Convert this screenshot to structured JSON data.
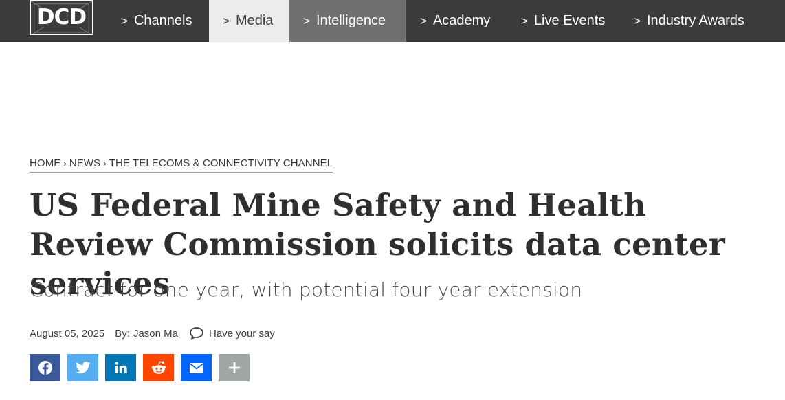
{
  "header": {
    "logo_text": "DCD",
    "nav": [
      {
        "caret": ">",
        "label": "Channels"
      },
      {
        "caret": ">",
        "label": "Media"
      },
      {
        "caret": ">",
        "label": "Intelligence"
      },
      {
        "caret": ">",
        "label": "Academy"
      },
      {
        "caret": ">",
        "label": "Live Events"
      },
      {
        "caret": ">",
        "label": "Industry Awards"
      }
    ]
  },
  "breadcrumb": {
    "items": [
      "HOME",
      "NEWS",
      "THE TELECOMS & CONNECTIVITY CHANNEL"
    ],
    "separator": "›"
  },
  "article": {
    "title": "US Federal Mine Safety and Health Review Commission solicits data center services",
    "subtitle": "Contract for one year, with potential four year extension",
    "date": "August 05, 2025",
    "by_label": "By:",
    "author": "Jason Ma",
    "comment_label": "Have your say"
  },
  "share": [
    {
      "name": "facebook",
      "icon": "facebook-icon",
      "color": "#3b5998"
    },
    {
      "name": "twitter",
      "icon": "twitter-icon",
      "color": "#55acee"
    },
    {
      "name": "linkedin",
      "icon": "linkedin-icon",
      "color": "#0077b5"
    },
    {
      "name": "reddit",
      "icon": "reddit-icon",
      "color": "#ff4500"
    },
    {
      "name": "email",
      "icon": "email-icon",
      "color": "#0166ff"
    },
    {
      "name": "more",
      "icon": "plus-icon",
      "color": "#a0a6a6"
    }
  ],
  "colors": {
    "nav_background": "#3b3b3b",
    "nav_active_media": "#ececec",
    "nav_highlight_intelligence": "#6f6f6f",
    "text": "#2d2d2d"
  }
}
